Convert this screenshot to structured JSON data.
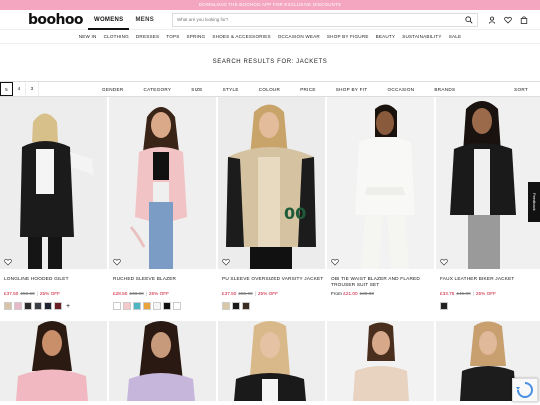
{
  "promo": "DOWNLOAD THE BOOHOO APP FOR EXCLUSIVE DISCOUNTS",
  "logo": "boohoo",
  "gender_tabs": [
    "WOMENS",
    "MENS"
  ],
  "search": {
    "placeholder": "What are you looking for?"
  },
  "nav": [
    "NEW IN",
    "CLOTHING",
    "DRESSES",
    "TOPS",
    "SPRING",
    "SHOES & ACCESSORIES",
    "OCCASION WEAR",
    "SHOP BY FIGURE",
    "BEAUTY",
    "SUSTAINABILITY",
    "SALE"
  ],
  "results_title": "SEARCH RESULTS FOR: JACKETS",
  "grid_options": [
    "5",
    "4",
    "3"
  ],
  "filters": [
    "GENDER",
    "CATEGORY",
    "SIZE",
    "STYLE",
    "COLOUR",
    "PRICE",
    "SHOP BY FIT",
    "OCCASION",
    "BRANDS"
  ],
  "sort_label": "SORT",
  "feedback_label": "Feedback",
  "products": [
    {
      "name": "LONGLINE HOODED GILET",
      "price": "£37.50",
      "was": "£50.00",
      "off": "25% OFF",
      "swatches": [
        "#d8c2a8",
        "#e8b9c6",
        "#2b2b2b",
        "#3a3d45",
        "#1f2230",
        "#6b1f24"
      ],
      "more": "+"
    },
    {
      "name": "RUCHED SLEEVE BLAZER",
      "price": "£28.50",
      "was": "£38.00",
      "off": "25% OFF",
      "swatches": [
        "#ffffff",
        "#f3c9c9",
        "#4db6c6",
        "#e8a33d",
        "#f5f5f5",
        "#111111",
        "#ffffff"
      ],
      "more": ""
    },
    {
      "name": "PU SLEEVE OVERSIZED VARSITY JACKET",
      "price": "£37.50",
      "was": "£50.00",
      "off": "25% OFF",
      "swatches": [
        "#d9c7a6",
        "#1a1a1a",
        "#3b2b20"
      ],
      "more": ""
    },
    {
      "name": "OBI TIE WAIST BLAZER AND FLARED TROUSER SUIT SET",
      "prefix": "From",
      "price": "£21.00",
      "was": "£28.00",
      "off": "",
      "swatches": [],
      "more": ""
    },
    {
      "name": "FAUX LEATHER BIKER JACKET",
      "price": "£33.75",
      "was": "£45.00",
      "off": "25% OFF",
      "swatches": [
        "#222222"
      ],
      "more": ""
    }
  ],
  "colors": {
    "promo": "#f4a6c0",
    "sale": "#c8102e"
  }
}
